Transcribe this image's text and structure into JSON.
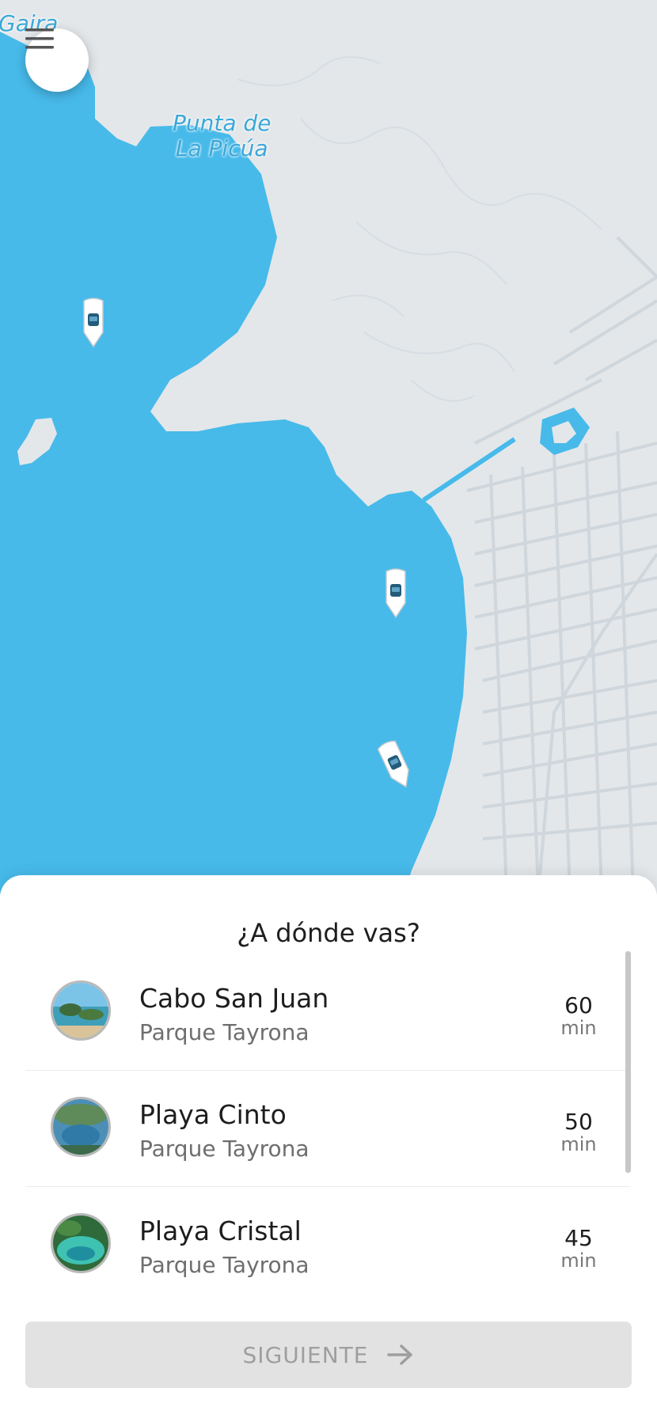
{
  "map": {
    "labels": {
      "gaira": "Gaira",
      "punta_line1": "Punta de",
      "punta_line2": "La Picúa"
    },
    "colors": {
      "water": "#47baea",
      "land": "#e3e7ea",
      "roads": "#cfd6dc"
    }
  },
  "menu": {
    "icon": "hamburger-menu-icon"
  },
  "sheet": {
    "title": "¿A dónde vas?",
    "destinations": [
      {
        "name": "Cabo San Juan",
        "subtitle": "Parque Tayrona",
        "time": "60",
        "unit": "min"
      },
      {
        "name": "Playa Cinto",
        "subtitle": "Parque Tayrona",
        "time": "50",
        "unit": "min"
      },
      {
        "name": "Playa Cristal",
        "subtitle": "Parque Tayrona",
        "time": "45",
        "unit": "min"
      }
    ],
    "next_button": {
      "label": "SIGUIENTE",
      "icon": "arrow-right-icon"
    }
  }
}
